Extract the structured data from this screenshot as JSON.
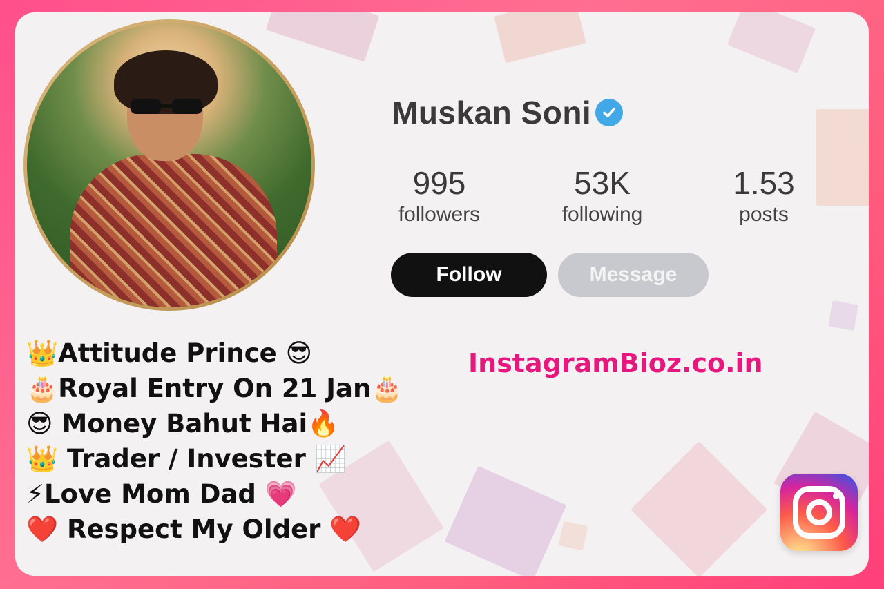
{
  "profile": {
    "name": "Muskan Soni",
    "stats": [
      {
        "value": "995",
        "label": "followers"
      },
      {
        "value": "53K",
        "label": "following"
      },
      {
        "value": "1.53",
        "label": "posts"
      }
    ],
    "buttons": {
      "follow": "Follow",
      "message": "Message"
    }
  },
  "brand": {
    "text": "InstagramBioz.co.in"
  },
  "bio": [
    "👑Attitude Prince 😎",
    "🎂Royal Entry On 21 Jan🎂",
    "😎 Money Bahut Hai🔥",
    "👑 Trader / Invester 📈",
    "⚡Love Mom Dad 💗",
    "❤️ Respect My Older ❤️"
  ],
  "colors": {
    "frame": "#ff5e7e",
    "brand": "#e5187d",
    "verified": "#43a8e8",
    "follow_bg": "#111111",
    "message_bg": "#c7c9ce"
  },
  "icons": {
    "verified": "verified-badge-icon",
    "logo": "instagram-logo-icon"
  }
}
